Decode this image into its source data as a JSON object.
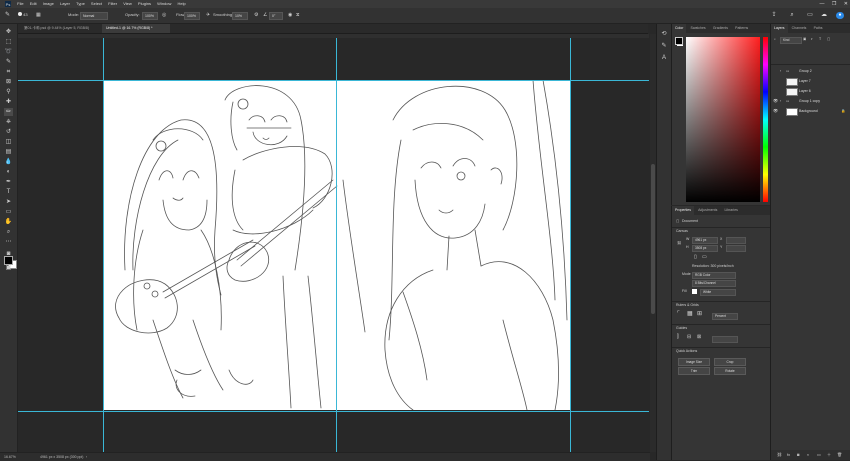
{
  "app": {
    "logo": "Ps"
  },
  "menubar": {
    "items": [
      "File",
      "Edit",
      "Image",
      "Layer",
      "Type",
      "Select",
      "Filter",
      "View",
      "Plugins",
      "Window",
      "Help"
    ]
  },
  "window_controls": {
    "minimize": "—",
    "restore": "❐",
    "close": "✕"
  },
  "options_bar": {
    "brush_size": "43",
    "mode_label": "Mode:",
    "mode_value": "Normal",
    "opacity_label": "Opacity:",
    "opacity_value": "100%",
    "flow_label": "Flow:",
    "flow_value": "100%",
    "smoothing_label": "Smoothing:",
    "smoothing_value": "10%",
    "angle_value": "0°"
  },
  "document_tabs": [
    {
      "label": "第01-卡莉.psd @ 9.44% (Layer 5, RGB/8)",
      "active": false
    },
    {
      "label": "Untitled-1 @ 16.7% (RGB/8) *",
      "active": true
    }
  ],
  "status_bar": {
    "zoom": "16.67%",
    "doc_info": "4961 px x 3508 px (300 ppi)"
  },
  "color_panel": {
    "tabs": [
      "Color",
      "Swatches",
      "Gradients",
      "Patterns"
    ],
    "foreground": "#000000",
    "background": "#ffffff",
    "hue_color": "#ff1f1f"
  },
  "layers_panel": {
    "tabs": [
      "Layers",
      "Channels",
      "Paths"
    ],
    "filter_label": "Kind",
    "layers": [
      {
        "name": "Group 2",
        "type": "group",
        "visible": false
      },
      {
        "name": "Layer 7",
        "type": "layer",
        "visible": false
      },
      {
        "name": "Layer 6",
        "type": "layer",
        "visible": false
      },
      {
        "name": "Group 1 copy",
        "type": "group",
        "visible": true
      },
      {
        "name": "Background",
        "type": "layer",
        "visible": true
      }
    ]
  },
  "properties_panel": {
    "tabs": [
      "Properties",
      "Adjustments",
      "Libraries"
    ],
    "document_label": "Document",
    "canvas_section": "Canvas",
    "width_label": "W",
    "width_value": "4961 px",
    "height_label": "H",
    "height_value": "3508 px",
    "x_label": "X",
    "y_label": "Y",
    "resolution": "Resolution: 300 pixels/inch",
    "mode_label": "Mode",
    "mode_value": "RGB Color",
    "bit_depth": "8 Bits/Channel",
    "fill_label": "Fill",
    "fill_value": "White",
    "rulers_section": "Rulers & Grids",
    "units_value": "Percent",
    "guides_section": "Guides",
    "quick_actions_section": "Quick Actions",
    "quick_actions": [
      "Image Size",
      "Crop",
      "Trim",
      "Rotate"
    ]
  }
}
